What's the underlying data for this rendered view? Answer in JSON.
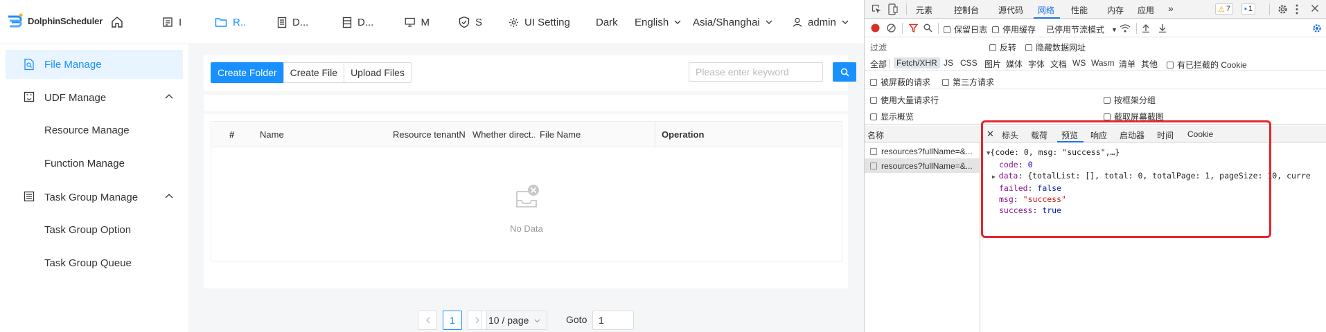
{
  "app": {
    "logo_text": "DolphinScheduler",
    "nav": [
      {
        "icon": "home-icon",
        "label": ""
      },
      {
        "icon": "project-icon",
        "label": "I"
      },
      {
        "icon": "folder-icon",
        "label": "R..",
        "active": true
      },
      {
        "icon": "datasource-icon",
        "label": "D..."
      },
      {
        "icon": "data-quality-icon",
        "label": "D..."
      },
      {
        "icon": "monitor-icon",
        "label": "M"
      },
      {
        "icon": "security-icon",
        "label": "S"
      },
      {
        "icon": "gear-icon",
        "label": "UI Setting"
      }
    ],
    "theme": "Dark",
    "language": "English",
    "timezone": "Asia/Shanghai",
    "user": "admin",
    "accent": "#1890ff"
  },
  "sidebar": {
    "file_manage": "File Manage",
    "udf_manage": "UDF Manage",
    "resource_manage": "Resource Manage",
    "function_manage": "Function Manage",
    "task_group_manage": "Task Group Manage",
    "task_group_option": "Task Group Option",
    "task_group_queue": "Task Group Queue"
  },
  "toolbar": {
    "create_folder": "Create Folder",
    "create_file": "Create File",
    "upload_files": "Upload Files",
    "search_placeholder": "Please enter keyword"
  },
  "table": {
    "columns": [
      "#",
      "Name",
      "Resource tenantNa...",
      "Whether direct...",
      "File Name",
      "Operation"
    ],
    "empty_text": "No Data"
  },
  "pagination": {
    "current_page": "1",
    "page_size": "10 / page",
    "goto_label": "Goto",
    "goto_value": "1"
  },
  "devtools": {
    "tabs": [
      "元素",
      "控制台",
      "源代码",
      "网络",
      "性能",
      "内存",
      "应用"
    ],
    "active_tab": "网络",
    "more": "»",
    "warnings": "7",
    "messages": "1",
    "toolbar": {
      "preserve_log": "保留日志",
      "disable_cache": "停用缓存",
      "throttle": "已停用节流模式"
    },
    "filter": {
      "label": "过滤",
      "invert": "反转",
      "hide_data_urls": "隐藏数据网址"
    },
    "types": [
      "全部",
      "Fetch/XHR",
      "JS",
      "CSS",
      "图片",
      "媒体",
      "字体",
      "文档",
      "WS",
      "Wasm",
      "清单",
      "其他"
    ],
    "selected_type": "Fetch/XHR",
    "blocked_cookies": "有已拦截的 Cookie",
    "blocked_requests": "被屏蔽的请求",
    "third_party": "第三方请求",
    "large_rows": "使用大量请求行",
    "group_by_frame": "按框架分组",
    "overview": "显示概览",
    "screenshots": "截取屏幕截图",
    "names_header": "名称",
    "requests": [
      "resources?fullName=&...",
      "resources?fullName=&..."
    ],
    "detail_tabs": [
      "标头",
      "载荷",
      "预览",
      "响应",
      "启动器",
      "时间",
      "Cookie"
    ],
    "active_detail_tab": "预览",
    "preview": {
      "summary": "{code: 0, msg: \"success\",…}",
      "code_key": "code",
      "code_val": "0",
      "data_key": "data",
      "data_val": "{totalList: [], total: 0, totalPage: 1, pageSize: 10, curre",
      "failed_key": "failed",
      "failed_val": "false",
      "msg_key": "msg",
      "msg_val": "\"success\"",
      "success_key": "success",
      "success_val": "true"
    },
    "highlight_color": "#e3262a"
  }
}
